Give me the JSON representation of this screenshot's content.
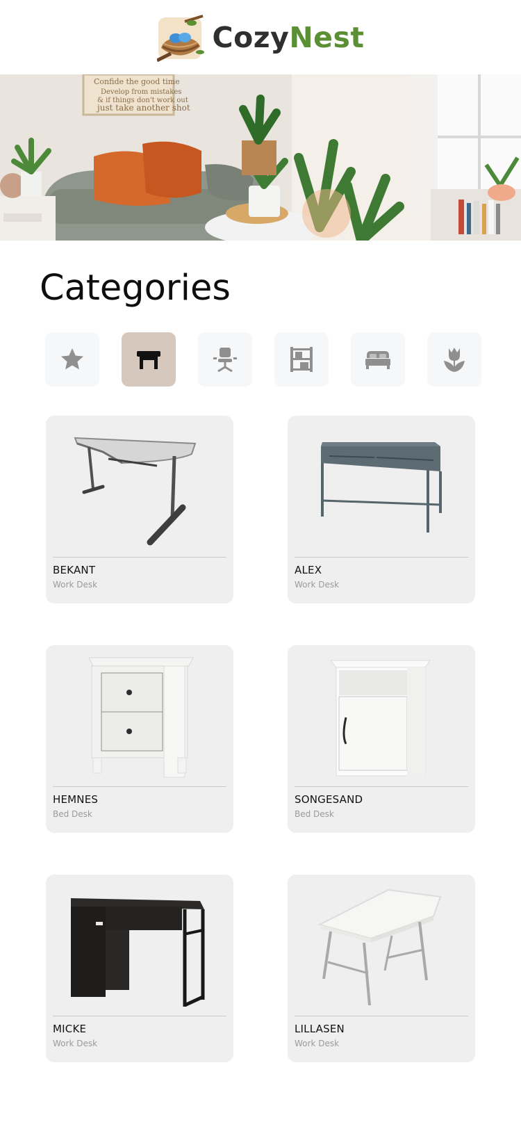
{
  "brand": {
    "part1": "Cozy",
    "part2": "Nest",
    "logo_icon": "bird-nest-icon"
  },
  "hero": {
    "image": "living-room-with-plants-photo"
  },
  "categories_section": {
    "title": "Categories",
    "items": [
      {
        "icon": "star-icon",
        "active": false
      },
      {
        "icon": "desk-icon",
        "active": true
      },
      {
        "icon": "office-chair-icon",
        "active": false
      },
      {
        "icon": "shelf-icon",
        "active": false
      },
      {
        "icon": "bed-icon",
        "active": false
      },
      {
        "icon": "tulip-icon",
        "active": false
      }
    ]
  },
  "products": [
    {
      "name": "BEKANT",
      "type": "Work Desk",
      "image": "corner-desk-image"
    },
    {
      "name": "ALEX",
      "type": "Work Desk",
      "image": "grey-drawer-desk-image"
    },
    {
      "name": "HEMNES",
      "type": "Bed Desk",
      "image": "two-drawer-nightstand-image"
    },
    {
      "name": "SONGESAND",
      "type": "Bed Desk",
      "image": "white-cabinet-nightstand-image"
    },
    {
      "name": "MICKE",
      "type": "Work Desk",
      "image": "black-desk-image"
    },
    {
      "name": "LILLASEN",
      "type": "Work Desk",
      "image": "white-legs-desk-image"
    }
  ],
  "colors": {
    "accent_green": "#5a8f34",
    "active_category_bg": "#d7c8bd",
    "card_bg": "#efefef"
  }
}
